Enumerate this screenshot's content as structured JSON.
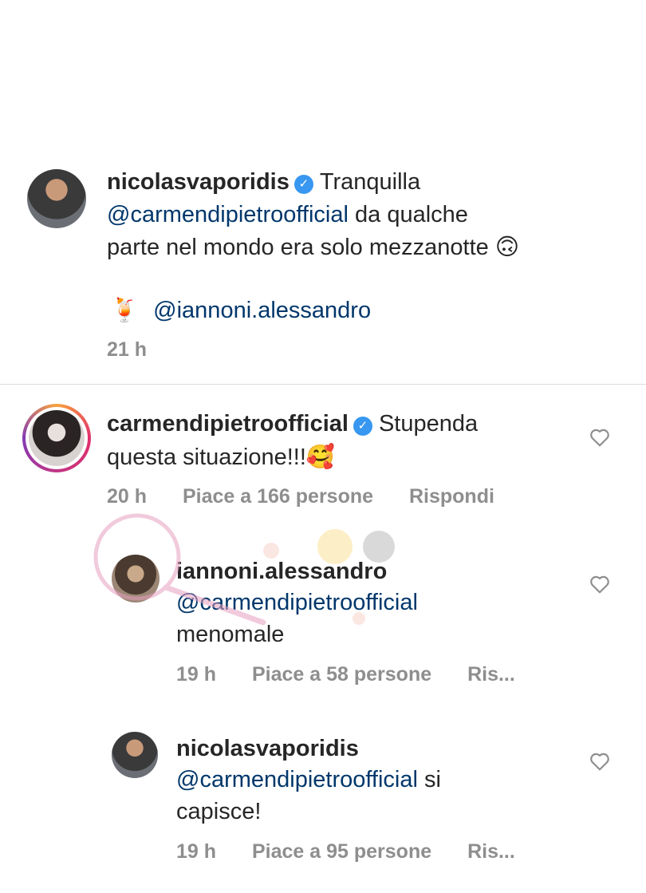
{
  "caption": {
    "username": "nicolasvaporidis",
    "text_part1": "Tranquilla",
    "mention": "@carmendipietroofficial",
    "text_part2": "da qualche",
    "text_line3": "parte nel mondo era solo mezzanotte",
    "emoji1": "🙃",
    "cocktail_emoji": "🍹",
    "mention2": "@iannoni.alessandro",
    "time": "21 h"
  },
  "comments": [
    {
      "username": "carmendipietroofficial",
      "text_line1": "Stupenda",
      "text_line2": "questa situazione!!!",
      "emoji": "🥰",
      "time": "20 h",
      "likes": "Piace a 166 persone",
      "reply": "Rispondi"
    },
    {
      "username": "iannoni.alessandro",
      "mention": "@carmendipietroofficial",
      "text": "menomale",
      "time": "19 h",
      "likes": "Piace a 58 persone",
      "reply": "Ris..."
    },
    {
      "username": "nicolasvaporidis",
      "mention": "@carmendipietroofficial",
      "text_part": "si",
      "text_line3": "capisce!",
      "time": "19 h",
      "likes": "Piace a 95 persone",
      "reply": "Ris..."
    }
  ],
  "colors": {
    "mention": "#00376b",
    "meta": "#8e8e8e",
    "verified": "#3897f0"
  },
  "icons": [
    "verified-badge-icon",
    "heart-outline-icon"
  ]
}
